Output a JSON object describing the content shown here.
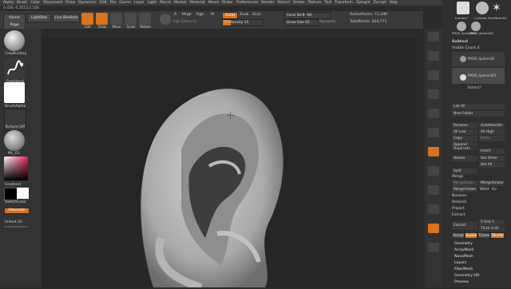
{
  "menubar": [
    "Alpha",
    "Brush",
    "Color",
    "Document",
    "Draw",
    "Dynamics",
    "Edit",
    "File",
    "Gizmo",
    "Layer",
    "Light",
    "Macro",
    "Marker",
    "Material",
    "Movie",
    "Picker",
    "Preferences",
    "Render",
    "Stencil",
    "Stroke",
    "Texture",
    "Tool",
    "Transform",
    "Zplugin",
    "Zscript",
    "Help"
  ],
  "coords": "0.456,-0.2053,0.106",
  "topbar": {
    "home_page": "Home Page",
    "lightbox": "LightBox",
    "live_boolean": "Live Boolean",
    "edit": "Edit",
    "draw": "Draw",
    "move": "Move",
    "scale": "Scale",
    "rotate": "Rotate",
    "a_label": "A",
    "mrgb": "Mrgb",
    "rgb": "Rgb",
    "m": "M",
    "rgb_intensity": "Rgb Intensity",
    "zadd": "Zadd",
    "zsub": "Zsub",
    "zcut": "Zcut",
    "z_intensity": "Z Intensity 15",
    "focal_shift": "Focal Shift -96",
    "draw_size": "Draw Size 65",
    "dynamic": "Dynamic",
    "active_points": "ActivePoints: 72,346",
    "total_points": "TotalPoints: 424,771"
  },
  "left": {
    "brush_name": "ClayBuildup",
    "stroke_name": "FreeHand",
    "alpha_name": "BrushAlpha",
    "texture_name": "Texture Off",
    "material_name": "ML_01",
    "gradient": "Gradient",
    "switch_color": "SwitchColor",
    "alternate": "Alternate",
    "imbed": "Imbed 20"
  },
  "right_shelf": [
    "Persp",
    "Floor",
    "Local",
    "Frame",
    "Move",
    "Zoom3D",
    "Rotate",
    "PolyF",
    "Transp",
    "Ghost",
    "Solo",
    "Xpose"
  ],
  "right_panel": {
    "subtool_title": "Subtool",
    "visible_count": "Visible Count 4",
    "subtools": [
      "PM3D_Sphere3D",
      "PM3D_Sphere3D1",
      "Extract7"
    ],
    "thumbs": [
      "Extract7",
      "Cylinder PolyMesh3D",
      "PM3D_Sphere3D",
      "PM3D_Sphere3D"
    ],
    "list_all": "List All",
    "new_folder": "New Folder",
    "rename": "Rename",
    "auto_reorder": "AutoReorder",
    "all_low": "All Low",
    "all_high": "All High",
    "copy": "Copy",
    "paste": "Paste",
    "duplicate": "Duplicate",
    "append": "Append",
    "insert": "Insert",
    "delete": "Delete",
    "del_other": "Del Other",
    "del_all": "Del All",
    "split": "Split",
    "merge": "Merge",
    "merge_down": "MergeDown",
    "merge_similar": "MergeSimilar",
    "merge_visible": "MergeVisible",
    "weld": "Weld",
    "uv": "Uv",
    "boolean": "Boolean",
    "remesh": "Remesh",
    "project": "Project",
    "extract_header": "Extract",
    "extract_btn": "Extract",
    "s_smt": "S Smt 5",
    "thick": "Thick 0.02",
    "accept": "Accept",
    "double": "Double",
    "tcorne": "TCorne",
    "tborder": "TBorder",
    "menus": [
      "Geometry",
      "ArrayMesh",
      "NanoMesh",
      "Layers",
      "FiberMesh",
      "Geometry HD",
      "Preview"
    ]
  },
  "colors": {
    "accent": "#d9731f",
    "primary_color": "#000000",
    "secondary_color": "#ffffff"
  }
}
